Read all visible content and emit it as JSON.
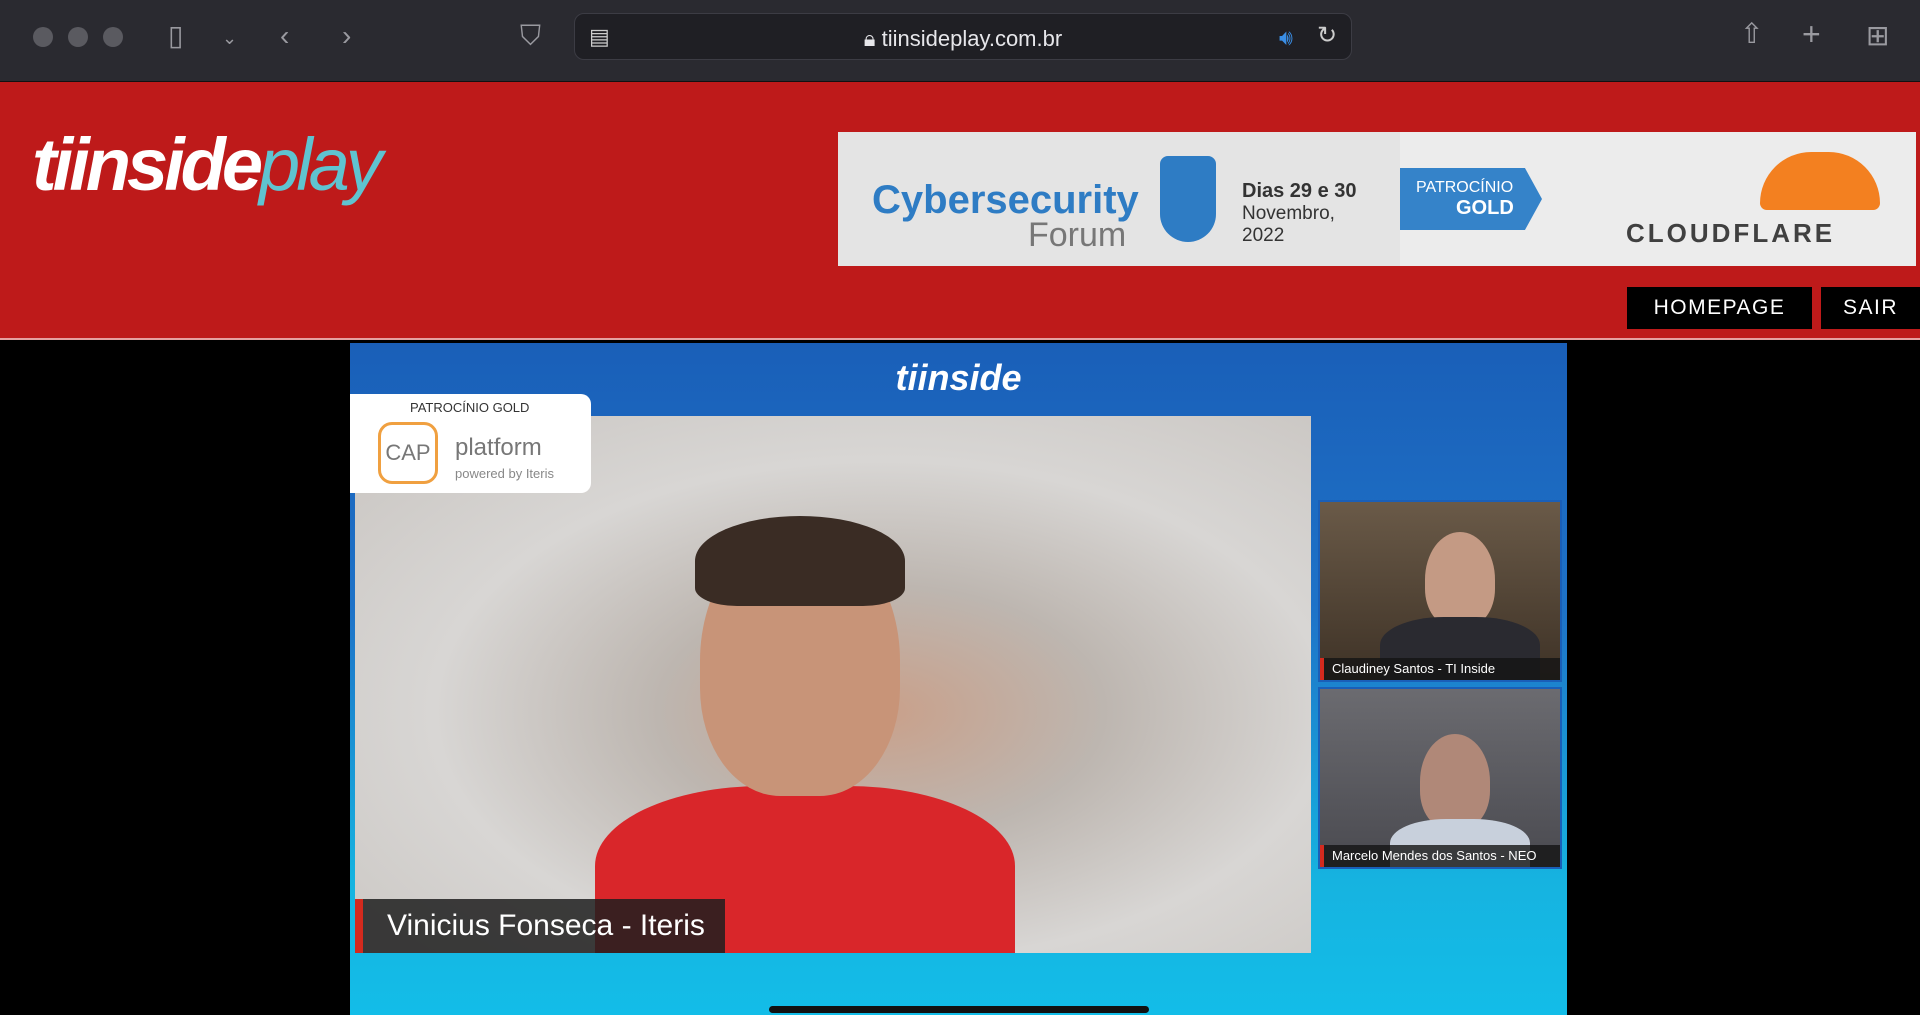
{
  "browser": {
    "url": "tiinsideplay.com.br",
    "icons": [
      "window-controls",
      "sidebar-icon",
      "chevron-down-icon",
      "back-icon",
      "forward-icon",
      "shield-icon",
      "reader-icon",
      "lock-icon",
      "speaker-icon",
      "reload-icon",
      "share-icon",
      "new-tab-icon",
      "tab-overview-icon"
    ]
  },
  "header": {
    "logo_ti": "tiinside",
    "logo_play": "play",
    "banner": {
      "title1": "Cybersecurity",
      "title2": "Forum",
      "dates_line1": "Dias 29 e 30",
      "dates_line2": "Novembro,",
      "dates_line3": "2022",
      "sponsor_label": "PATROCÍNIO",
      "sponsor_tier": "GOLD",
      "sponsor_name": "CLOUDFLARE"
    },
    "nav": [
      {
        "label": "HOMEPAGE"
      },
      {
        "label": "SAIR"
      }
    ],
    "accent": "#be1a1a"
  },
  "stream": {
    "watermark": "tiinside",
    "sponsor_card": {
      "heading": "PATROCÍNIO GOLD",
      "cap": "CAP",
      "platform": "platform",
      "powered": "powered by Iteris"
    },
    "main_speaker": "Vinicius Fonseca - Iteris",
    "participants": [
      {
        "name": "Claudiney Santos - TI Inside"
      },
      {
        "name": "Marcelo Mendes dos Santos - NEO"
      }
    ]
  }
}
